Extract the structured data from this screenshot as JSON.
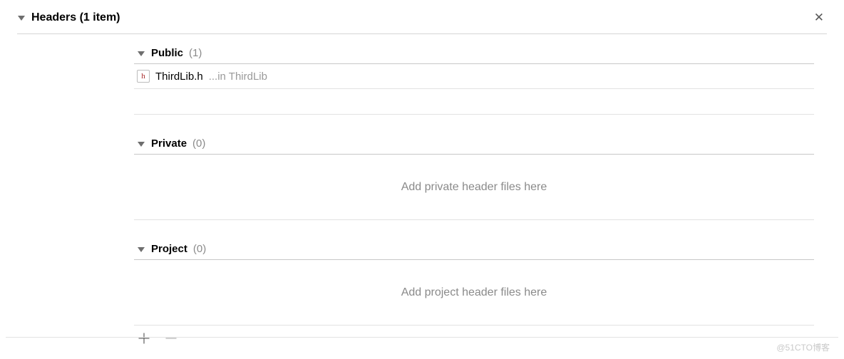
{
  "header": {
    "title": "Headers (1 item)"
  },
  "sections": {
    "public": {
      "title": "Public",
      "count": "(1)"
    },
    "private": {
      "title": "Private",
      "count": "(0)",
      "placeholder": "Add private header files here"
    },
    "project": {
      "title": "Project",
      "count": "(0)",
      "placeholder": "Add project header files here"
    }
  },
  "files": {
    "public": [
      {
        "icon_letter": "h",
        "name": "ThirdLib.h",
        "path": "...in ThirdLib"
      }
    ]
  },
  "watermark": "@51CTO博客"
}
